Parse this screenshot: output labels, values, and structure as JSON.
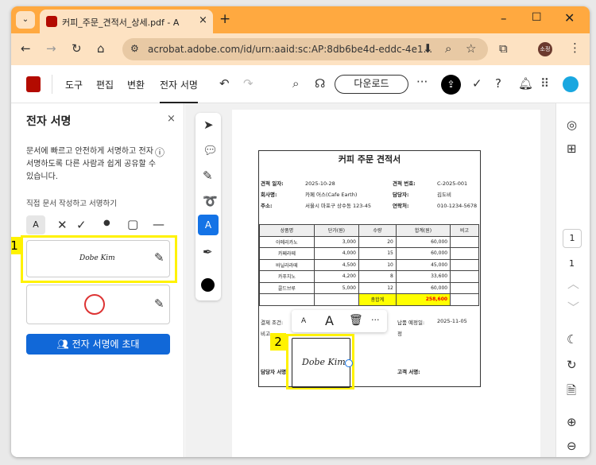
{
  "browser": {
    "tab_title": "커피_주문_견적서_상세.pdf - A",
    "url": "acrobat.adobe.com/id/urn:aaid:sc:AP:8db6be4d-eddc-4e1...",
    "profile": "소정"
  },
  "toolbar": {
    "menu": [
      "도구",
      "편집",
      "변환",
      "전자 서명"
    ],
    "download": "다운로드"
  },
  "panel": {
    "title": "전자 서명",
    "description": "문서에 빠르고 안전하게 서명하고 전자 서명하도록 다른 사람과 쉽게 공유할 수 있습니다.",
    "section": "직접 문서 작성하고 서명하기",
    "signature_text": "Dobe Kim",
    "invite_button": "전자 서명에 초대"
  },
  "doc": {
    "title": "커피 주문 견적서",
    "info": [
      [
        "견적 일자:",
        "2025-10-28",
        "견적 번호:",
        "C-2025-001"
      ],
      [
        "회사명:",
        "카페 어스(Cafe Earth)",
        "담당자:",
        "김도비"
      ],
      [
        "주소:",
        "서울시 마포구 상수동 123-45",
        "연락처:",
        "010-1234-5678"
      ]
    ],
    "headers": [
      "상품명",
      "단가(원)",
      "수량",
      "합계(원)",
      "비고"
    ],
    "rows": [
      [
        "아메리카노",
        "3,000",
        "20",
        "60,000",
        ""
      ],
      [
        "카페라떼",
        "4,000",
        "15",
        "60,000",
        ""
      ],
      [
        "바닐라라떼",
        "4,500",
        "10",
        "45,000",
        ""
      ],
      [
        "카푸치노",
        "4,200",
        "8",
        "33,600",
        ""
      ],
      [
        "콜드브루",
        "5,000",
        "12",
        "60,000",
        ""
      ]
    ],
    "total_label": "총합계",
    "total": "258,600",
    "payment_label": "결제 조건:",
    "note_label": "비고",
    "delivery_label": "납품 예정일:",
    "delivery_date": "2025-11-05",
    "note_tail": "정",
    "staff_sign_label": "담당자 서명:",
    "customer_sign_label": "고객 서명:",
    "signature": "Dobe Kim"
  },
  "popup": {
    "small_a": "A",
    "large_a": "A",
    "more": "···"
  },
  "annotations": [
    "1",
    "2"
  ],
  "rail": {
    "page_input": "1",
    "page_total": "1"
  }
}
